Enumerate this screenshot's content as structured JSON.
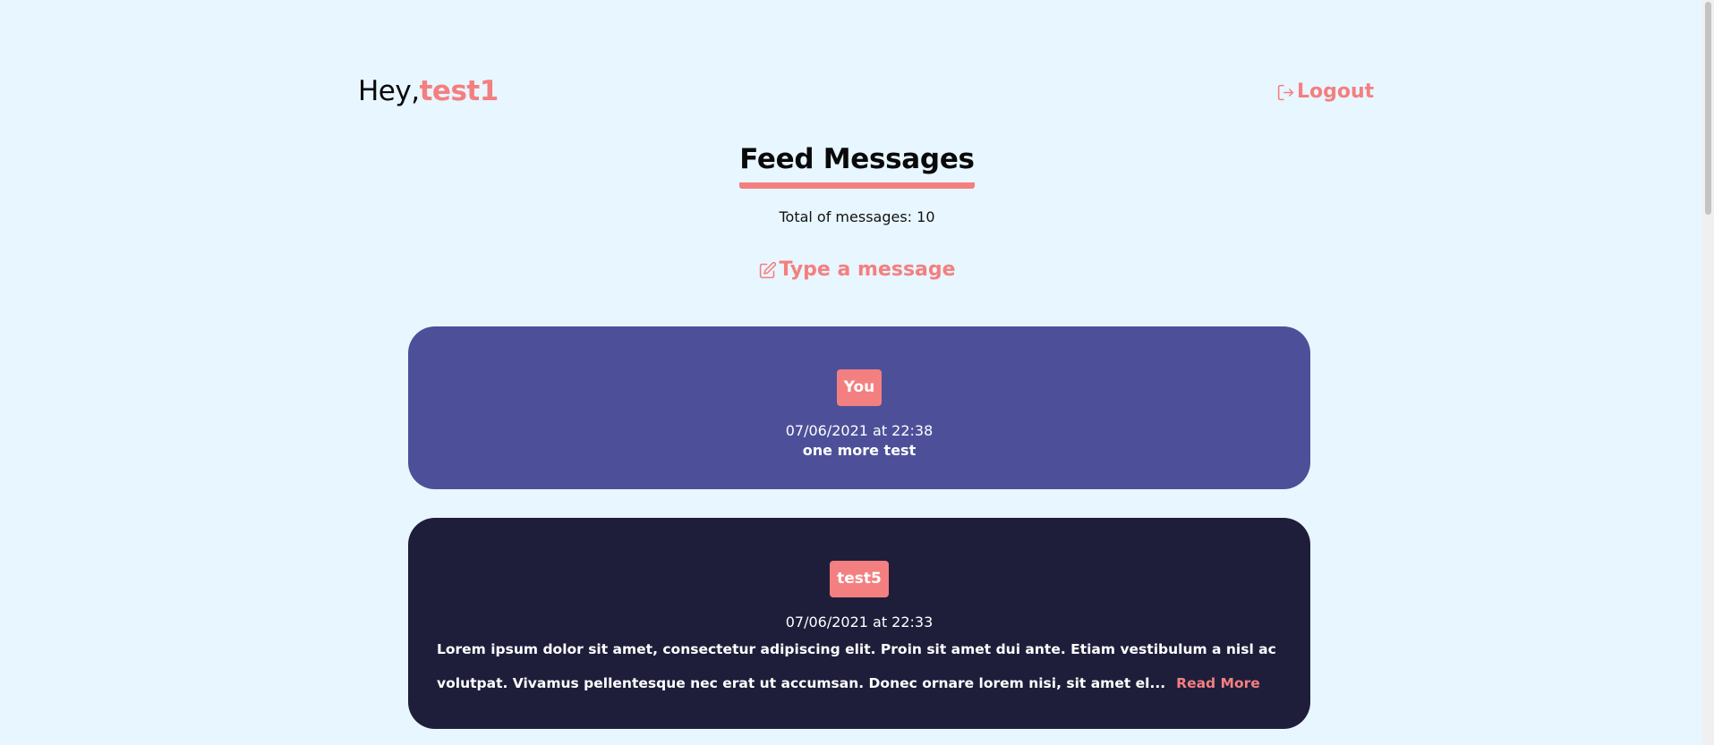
{
  "header": {
    "greeting": "Hey,",
    "username": "test1",
    "logout_label": "Logout"
  },
  "feed": {
    "title": "Feed Messages",
    "total_label": "Total of messages: 10",
    "compose_label": "Type a message",
    "messages": [
      {
        "author": "You",
        "date": "07/06/2021 at 22:38",
        "text": "one more test"
      },
      {
        "author": "test5",
        "date": "07/06/2021 at 22:33",
        "text": "Lorem ipsum dolor sit amet, consectetur adipiscing elit. Proin sit amet dui ante. Etiam vestibulum a nisl ac volutpat. Vivamus pellentesque nec erat ut accumsan. Donec ornare lorem nisi, sit amet el...",
        "read_more_label": "Read More"
      }
    ]
  },
  "icons": {
    "logout": "logout-icon",
    "compose": "edit-icon"
  },
  "colors": {
    "background": "#e8f6ff",
    "accent": "#f47f80",
    "own_message_card": "#4d5099",
    "other_message_card": "#1e1e3b"
  }
}
